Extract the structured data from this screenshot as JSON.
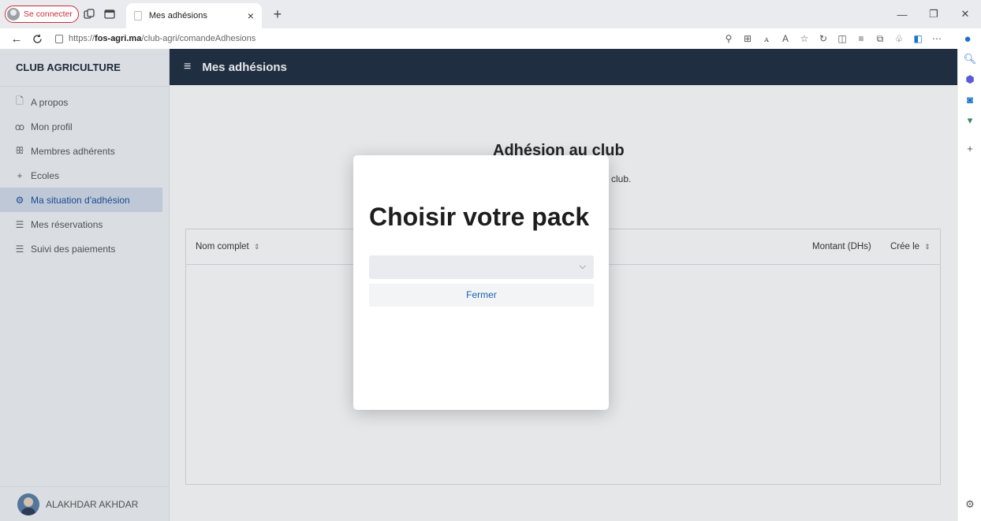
{
  "browser": {
    "profile_label": "Se connecter",
    "tab_title": "Mes adhésions",
    "tab_close": "×",
    "new_tab": "+",
    "url_prefix": "https://",
    "url_domain": "fos-agri.ma",
    "url_path": "/club-agri/comandeAdhesions",
    "window_controls": {
      "minimize": "—",
      "restore": "❐",
      "close": "✕"
    }
  },
  "sidebar": {
    "brand": "CLUB AGRICULTURE",
    "items": [
      {
        "label": "A propos",
        "icon": "document-icon",
        "active": false
      },
      {
        "label": "Mon profil",
        "icon": "people-icon",
        "active": false
      },
      {
        "label": "Membres adhérents",
        "icon": "members-icon",
        "active": false
      },
      {
        "label": "Ecoles",
        "icon": "plus-icon",
        "active": false
      },
      {
        "label": "Ma situation d'adhésion",
        "icon": "gear-icon",
        "active": true
      },
      {
        "label": "Mes réservations",
        "icon": "list-icon",
        "active": false
      },
      {
        "label": "Suivi des paiements",
        "icon": "list-icon",
        "active": false
      }
    ],
    "user_name": "ALAKHDAR AKHDAR"
  },
  "header": {
    "title": "Mes adhésions"
  },
  "main": {
    "title": "Adhésion au club",
    "subtitle_fragment": "club.",
    "table": {
      "columns": [
        "Nom complet",
        "Montant (DHs)",
        "Crée le"
      ],
      "sort_indicator": "⇕"
    }
  },
  "modal": {
    "title": "Choisir votre pack",
    "select_value": "",
    "close_label": "Fermer"
  },
  "colors": {
    "topbar": "#1f2d40",
    "active_item_bg": "#d3dcea",
    "accent": "#1a5fb4"
  }
}
